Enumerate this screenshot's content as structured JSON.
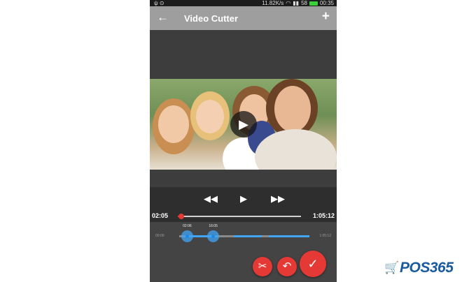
{
  "status_bar": {
    "speed": "11.82K/s",
    "signal": "58",
    "time": "00:35"
  },
  "toolbar": {
    "back_icon": "arrow-left-icon",
    "title": "Video Cutter",
    "add_icon": "plus-icon"
  },
  "player": {
    "current_time": "02:05",
    "total_time": "1:05:12",
    "progress_fraction": 0.03
  },
  "trim": {
    "start_label": "02:06",
    "end_label": "16:05",
    "min_label": "00:00",
    "max_label": "1:05:12",
    "start_fraction": 0.06,
    "end_fraction": 0.26
  },
  "actions": [
    "scissors-icon",
    "undo-icon",
    "checkmark-icon"
  ],
  "watermark": {
    "brand": "POS365"
  },
  "colors": {
    "accent": "#e53935",
    "selection": "#42a5f5",
    "toolbar": "#9e9e9e",
    "brand": "#1a5aa0"
  }
}
